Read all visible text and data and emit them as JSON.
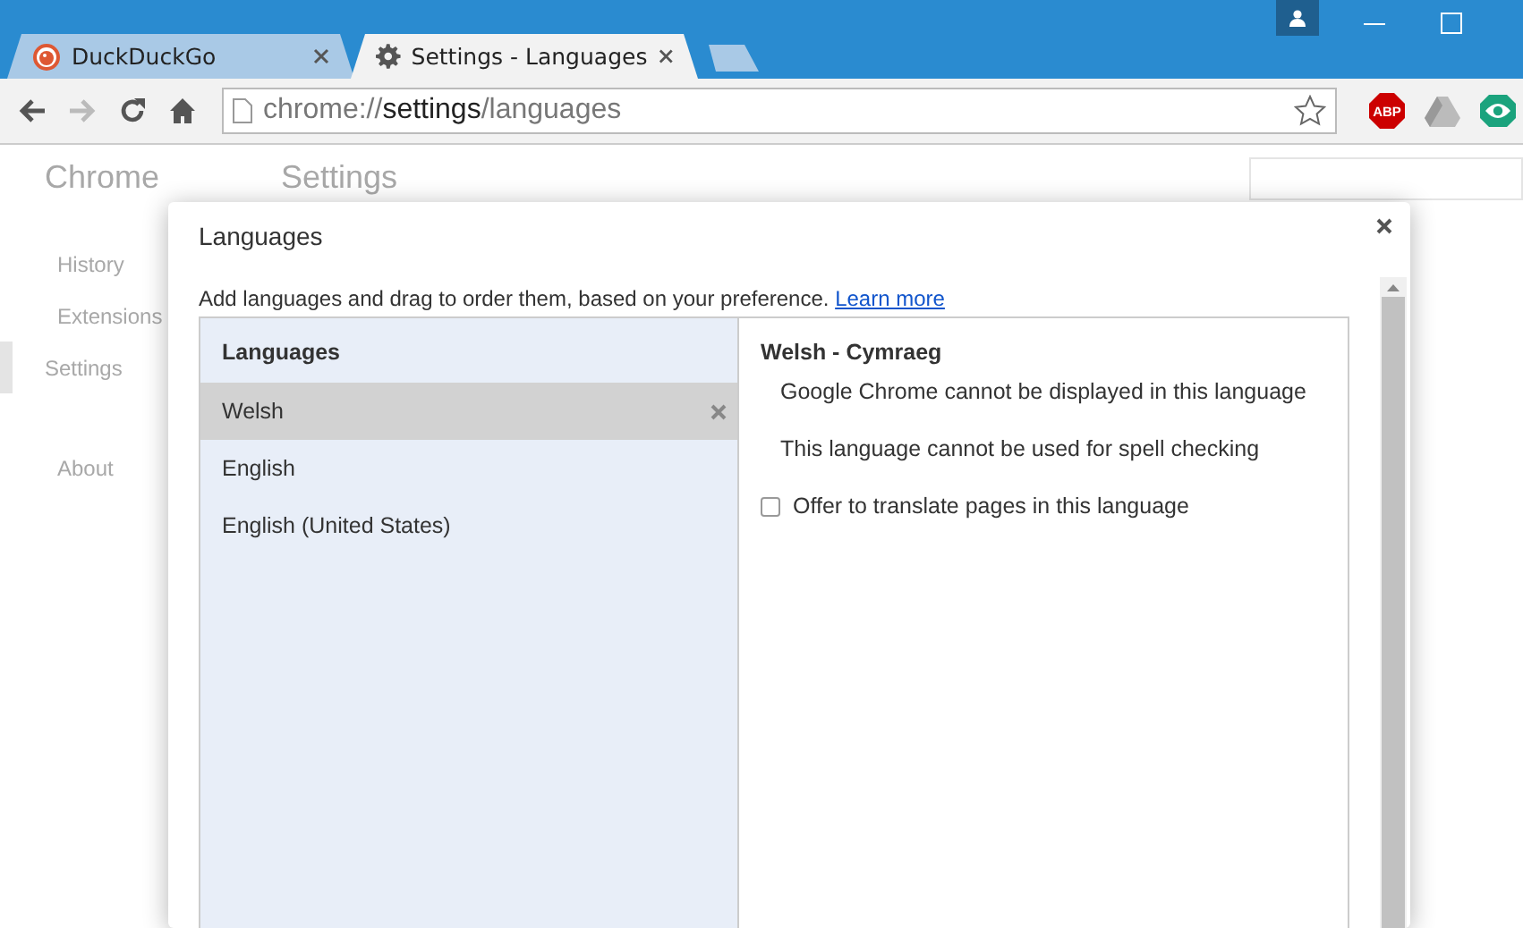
{
  "browser": {
    "tabs": [
      {
        "title": "DuckDuckGo",
        "selected": false
      },
      {
        "title": "Settings - Languages",
        "selected": true
      }
    ],
    "extension_badge": "ABP",
    "address": {
      "scheme": "chrome://",
      "host": "settings",
      "path": "/languages"
    }
  },
  "settings_page": {
    "brand": "Chrome",
    "heading": "Settings",
    "nav": [
      {
        "label": "History",
        "selected": false
      },
      {
        "label": "Extensions",
        "selected": false
      },
      {
        "label": "Settings",
        "selected": true
      },
      {
        "label": "About",
        "selected": false
      }
    ]
  },
  "dialog": {
    "title": "Languages",
    "description": "Add languages and drag to order them, based on your preference.",
    "link": "Learn more",
    "list_heading": "Languages",
    "languages": [
      {
        "name": "Welsh",
        "selected": true
      },
      {
        "name": "English",
        "selected": false
      },
      {
        "name": "English (United States)",
        "selected": false
      }
    ],
    "detail": {
      "heading": "Welsh - Cymraeg",
      "notes": [
        "Google Chrome cannot be displayed in this language",
        "This language cannot be used for spell checking"
      ],
      "option": {
        "label": "Offer to translate pages in this language",
        "checked": false
      }
    }
  }
}
